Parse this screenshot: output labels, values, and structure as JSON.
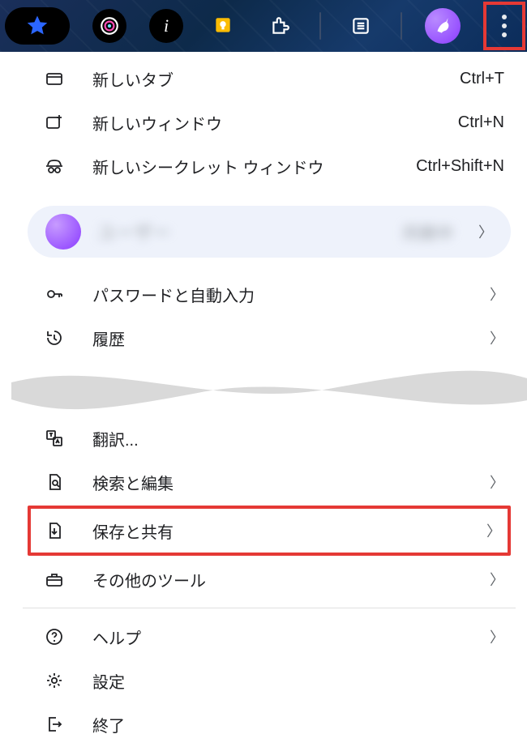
{
  "toolbar": {
    "items": [
      "star",
      "camera",
      "info",
      "keep",
      "extensions",
      "reading-list"
    ],
    "avatar": true
  },
  "menu": {
    "new_tab": {
      "label": "新しいタブ",
      "shortcut": "Ctrl+T"
    },
    "new_window": {
      "label": "新しいウィンドウ",
      "shortcut": "Ctrl+N"
    },
    "new_incognito": {
      "label": "新しいシークレット ウィンドウ",
      "shortcut": "Ctrl+Shift+N"
    },
    "profile": {
      "name": "ユーザー",
      "status": "同期中"
    },
    "passwords": {
      "label": "パスワードと自動入力"
    },
    "history": {
      "label": "履歴"
    },
    "translate": {
      "label": "翻訳..."
    },
    "find_edit": {
      "label": "検索と編集"
    },
    "save_share": {
      "label": "保存と共有"
    },
    "more_tools": {
      "label": "その他のツール"
    },
    "help": {
      "label": "ヘルプ"
    },
    "settings": {
      "label": "設定"
    },
    "exit": {
      "label": "終了"
    }
  }
}
